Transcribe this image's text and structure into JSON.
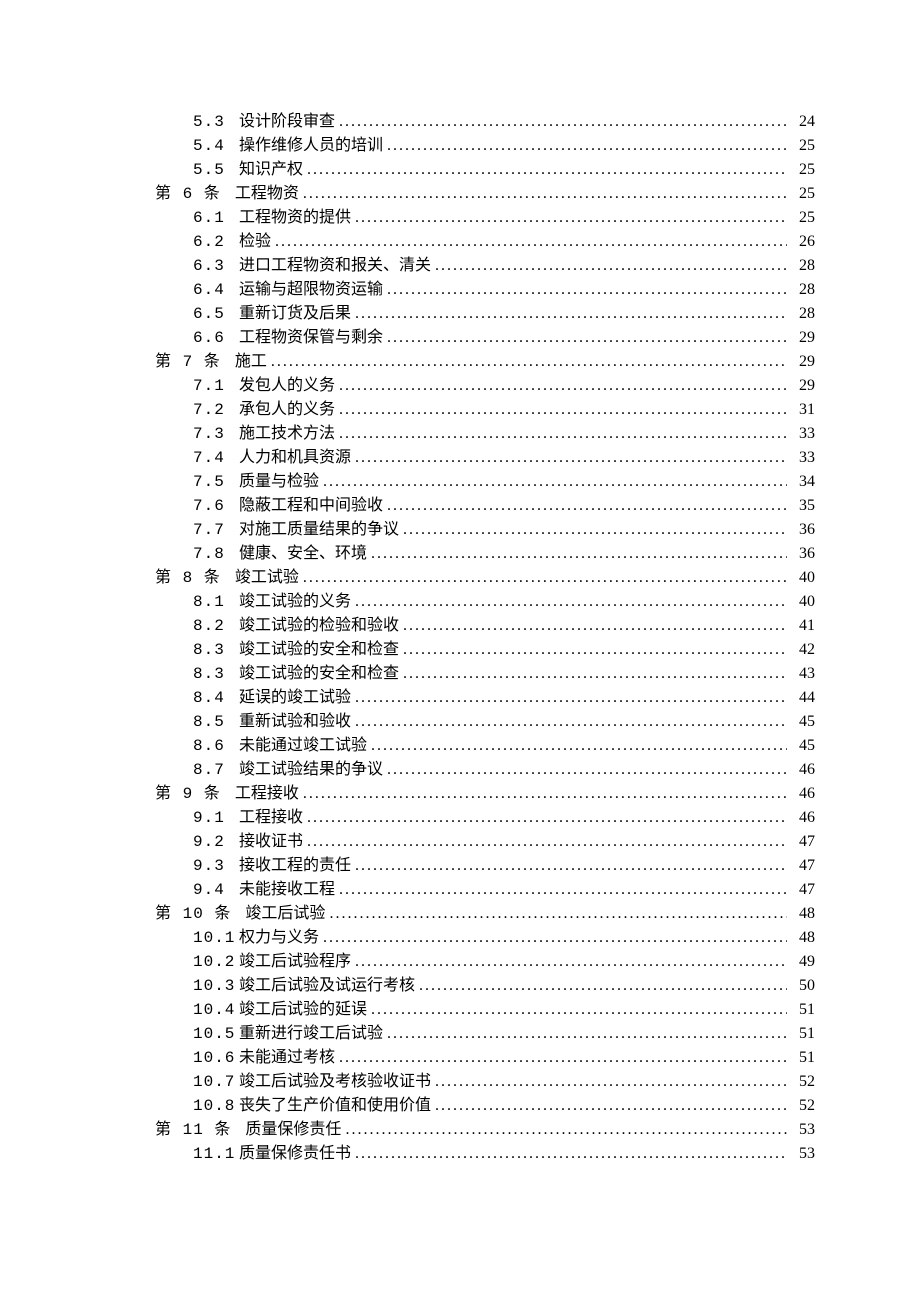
{
  "toc": [
    {
      "level": 2,
      "num": "5.3",
      "title": "设计阶段审查",
      "page": "24"
    },
    {
      "level": 2,
      "num": "5.4",
      "title": "操作维修人员的培训",
      "page": "25"
    },
    {
      "level": 2,
      "num": "5.5",
      "title": "知识产权",
      "page": "25"
    },
    {
      "level": 1,
      "num": "第 6 条",
      "title": "工程物资",
      "page": "25"
    },
    {
      "level": 2,
      "num": "6.1",
      "title": "工程物资的提供",
      "page": "25"
    },
    {
      "level": 2,
      "num": "6.2",
      "title": "检验",
      "page": "26"
    },
    {
      "level": 2,
      "num": "6.3",
      "title": "进口工程物资和报关、清关",
      "page": "28"
    },
    {
      "level": 2,
      "num": "6.4",
      "title": "运输与超限物资运输",
      "page": "28"
    },
    {
      "level": 2,
      "num": "6.5",
      "title": "重新订货及后果",
      "page": "28"
    },
    {
      "level": 2,
      "num": "6.6",
      "title": "工程物资保管与剩余",
      "page": "29"
    },
    {
      "level": 1,
      "num": "第 7 条",
      "title": "施工",
      "page": "29"
    },
    {
      "level": 2,
      "num": "7.1",
      "title": "发包人的义务",
      "page": "29"
    },
    {
      "level": 2,
      "num": "7.2",
      "title": "承包人的义务",
      "page": "31"
    },
    {
      "level": 2,
      "num": "7.3",
      "title": "施工技术方法",
      "page": "33"
    },
    {
      "level": 2,
      "num": "7.4",
      "title": "人力和机具资源",
      "page": "33"
    },
    {
      "level": 2,
      "num": "7.5",
      "title": "质量与检验",
      "page": "34"
    },
    {
      "level": 2,
      "num": "7.6",
      "title": "隐蔽工程和中间验收",
      "page": "35"
    },
    {
      "level": 2,
      "num": "7.7",
      "title": "对施工质量结果的争议",
      "page": "36"
    },
    {
      "level": 2,
      "num": "7.8",
      "title": "健康、安全、环境",
      "page": "36"
    },
    {
      "level": 1,
      "num": "第 8 条",
      "title": "竣工试验",
      "page": "40"
    },
    {
      "level": 2,
      "num": "8.1",
      "title": "竣工试验的义务",
      "page": "40"
    },
    {
      "level": 2,
      "num": "8.2",
      "title": "竣工试验的检验和验收",
      "page": "41"
    },
    {
      "level": 2,
      "num": "8.3",
      "title": "竣工试验的安全和检查",
      "page": "42"
    },
    {
      "level": 2,
      "num": "8.3",
      "title": "竣工试验的安全和检查",
      "page": "43"
    },
    {
      "level": 2,
      "num": "8.4",
      "title": "延误的竣工试验",
      "page": "44"
    },
    {
      "level": 2,
      "num": "8.5",
      "title": "重新试验和验收",
      "page": "45"
    },
    {
      "level": 2,
      "num": "8.6",
      "title": "未能通过竣工试验",
      "page": "45"
    },
    {
      "level": 2,
      "num": "8.7",
      "title": "竣工试验结果的争议",
      "page": "46"
    },
    {
      "level": 1,
      "num": "第 9 条",
      "title": "工程接收",
      "page": "46"
    },
    {
      "level": 2,
      "num": "9.1",
      "title": "工程接收",
      "page": "46"
    },
    {
      "level": 2,
      "num": "9.2",
      "title": "接收证书",
      "page": "47"
    },
    {
      "level": 2,
      "num": "9.3",
      "title": "接收工程的责任",
      "page": "47"
    },
    {
      "level": 2,
      "num": "9.4",
      "title": "未能接收工程",
      "page": "47"
    },
    {
      "level": 1,
      "num": "第 10 条",
      "title": "竣工后试验",
      "page": "48"
    },
    {
      "level": 2,
      "num": "10.1",
      "title": "权力与义务",
      "page": "48"
    },
    {
      "level": 2,
      "num": "10.2",
      "title": "竣工后试验程序",
      "page": "49"
    },
    {
      "level": 2,
      "num": "10.3",
      "title": "竣工后试验及试运行考核",
      "page": "50"
    },
    {
      "level": 2,
      "num": "10.4",
      "title": "竣工后试验的延误",
      "page": "51"
    },
    {
      "level": 2,
      "num": "10.5",
      "title": "重新进行竣工后试验",
      "page": "51"
    },
    {
      "level": 2,
      "num": "10.6",
      "title": "未能通过考核",
      "page": "51"
    },
    {
      "level": 2,
      "num": "10.7",
      "title": "竣工后试验及考核验收证书",
      "page": "52"
    },
    {
      "level": 2,
      "num": "10.8",
      "title": "丧失了生产价值和使用价值",
      "page": "52"
    },
    {
      "level": 1,
      "num": "第 11 条",
      "title": "质量保修责任",
      "page": "53"
    },
    {
      "level": 2,
      "num": "11.1",
      "title": "质量保修责任书",
      "page": "53"
    }
  ]
}
